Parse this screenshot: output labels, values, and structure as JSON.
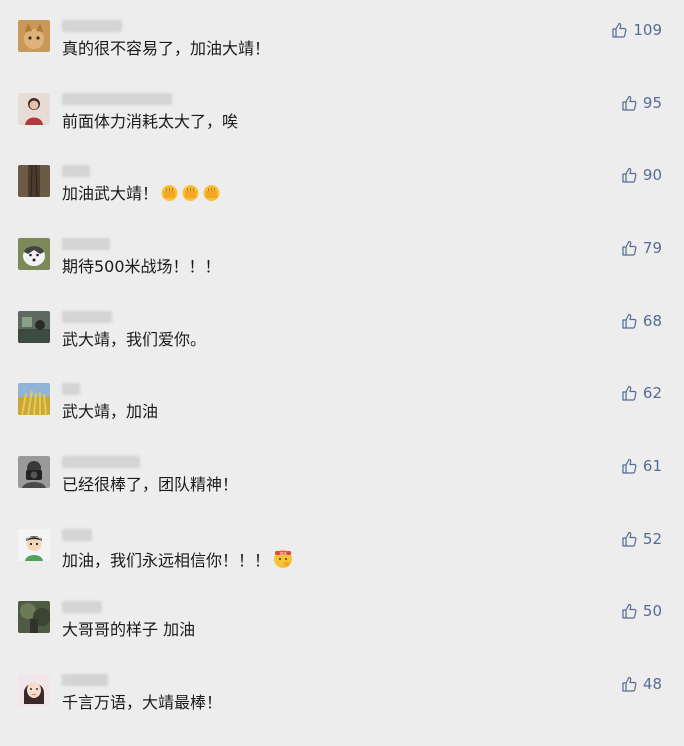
{
  "comments": [
    {
      "text": "真的很不容易了，加油大靖！",
      "likes": "109",
      "avatar": "cat"
    },
    {
      "text": "前面体力消耗太大了，唉",
      "likes": "95",
      "avatar": "person-red"
    },
    {
      "text": "加油武大靖！",
      "likes": "90",
      "avatar": "tree-bark",
      "emoji": [
        "fist-emoji",
        "fist-emoji",
        "fist-emoji"
      ]
    },
    {
      "text": "期待500米战场！！！",
      "likes": "79",
      "avatar": "husky-dog"
    },
    {
      "text": "武大靖，我们爱你。",
      "likes": "68",
      "avatar": "outdoor-photo"
    },
    {
      "text": "武大靖，加油",
      "likes": "62",
      "avatar": "wheat-field"
    },
    {
      "text": "已经很棒了，团队精神！",
      "likes": "61",
      "avatar": "camera-person"
    },
    {
      "text": "加油，我们永远相信你！！！",
      "likes": "52",
      "avatar": "cartoon-boy",
      "emoji": [
        "head-bandage-emoji"
      ]
    },
    {
      "text": "大哥哥的样子 加油",
      "likes": "50",
      "avatar": "forest-photo"
    },
    {
      "text": "千言万语，大靖最棒！",
      "likes": "48",
      "avatar": "girl-portrait"
    }
  ],
  "colors": {
    "background": "#ededed",
    "like_text": "#576b95",
    "comment_text": "#1a1a1a"
  }
}
